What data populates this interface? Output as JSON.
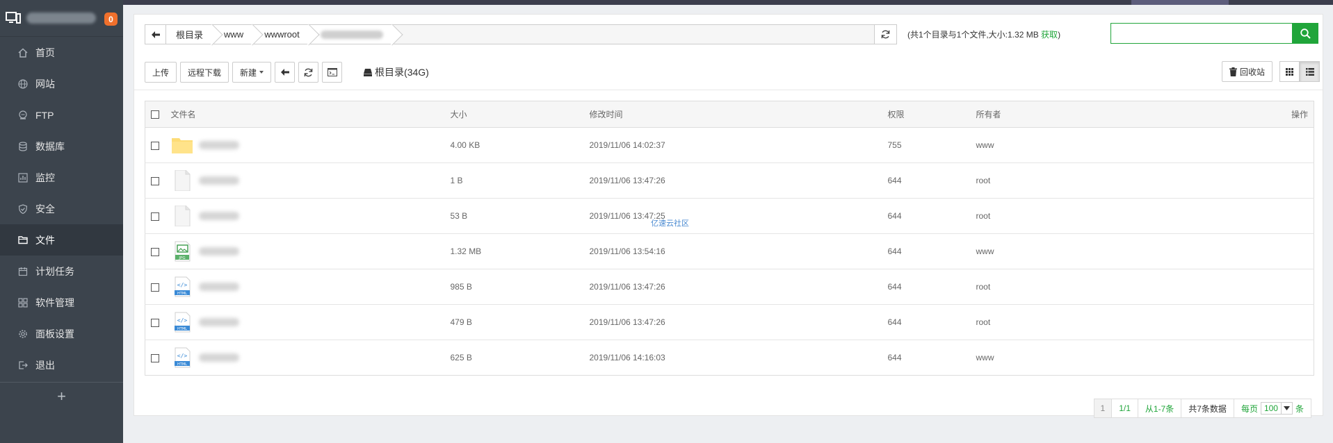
{
  "sidebar": {
    "badge_count": "0",
    "items": [
      {
        "label": "首页",
        "icon": "home-icon",
        "active": false
      },
      {
        "label": "网站",
        "icon": "globe-icon",
        "active": false
      },
      {
        "label": "FTP",
        "icon": "ftp-icon",
        "active": false
      },
      {
        "label": "数据库",
        "icon": "database-icon",
        "active": false
      },
      {
        "label": "监控",
        "icon": "monitor-chart-icon",
        "active": false
      },
      {
        "label": "安全",
        "icon": "shield-icon",
        "active": false
      },
      {
        "label": "文件",
        "icon": "folder-icon",
        "active": true
      },
      {
        "label": "计划任务",
        "icon": "calendar-icon",
        "active": false
      },
      {
        "label": "软件管理",
        "icon": "apps-icon",
        "active": false
      },
      {
        "label": "面板设置",
        "icon": "gear-icon",
        "active": false
      },
      {
        "label": "退出",
        "icon": "logout-icon",
        "active": false
      }
    ],
    "add_label": "+"
  },
  "path": {
    "crumbs": [
      "根目录",
      "www",
      "wwwroot"
    ],
    "info_prefix": "(共1个目录与1个文件,大小:1.32 MB ",
    "info_fetch": "获取",
    "info_suffix": ")"
  },
  "search": {
    "placeholder": "",
    "value": ""
  },
  "toolbar": {
    "upload": "上传",
    "remote_download": "远程下载",
    "new": "新建",
    "disk_label": "根目录(34G)",
    "recycle_bin": "回收站"
  },
  "table": {
    "headers": {
      "name": "文件名",
      "size": "大小",
      "modified": "修改时间",
      "perm": "权限",
      "owner": "所有者",
      "actions": "操作"
    },
    "rows": [
      {
        "type": "folder",
        "size": "4.00 KB",
        "modified": "2019/11/06 14:02:37",
        "perm": "755",
        "owner": "www"
      },
      {
        "type": "file",
        "size": "1 B",
        "modified": "2019/11/06 13:47:26",
        "perm": "644",
        "owner": "root"
      },
      {
        "type": "file",
        "size": "53 B",
        "modified": "2019/11/06 13:47:25",
        "perm": "644",
        "owner": "root"
      },
      {
        "type": "jpg",
        "size": "1.32 MB",
        "modified": "2019/11/06 13:54:16",
        "perm": "644",
        "owner": "www"
      },
      {
        "type": "html",
        "size": "985 B",
        "modified": "2019/11/06 13:47:26",
        "perm": "644",
        "owner": "root"
      },
      {
        "type": "html",
        "size": "479 B",
        "modified": "2019/11/06 13:47:26",
        "perm": "644",
        "owner": "root"
      },
      {
        "type": "html",
        "size": "625 B",
        "modified": "2019/11/06 14:16:03",
        "perm": "644",
        "owner": "www"
      }
    ]
  },
  "watermark": "亿速云社区",
  "pager": {
    "current": "1",
    "pages": "1/1",
    "range": "从1-7条",
    "total": "共7条数据",
    "per_page_label": "每页",
    "per_page_value": "100",
    "unit": "条"
  },
  "colors": {
    "accent": "#20a53a",
    "sidebar_bg": "#3c444d",
    "badge": "#f0702c"
  }
}
